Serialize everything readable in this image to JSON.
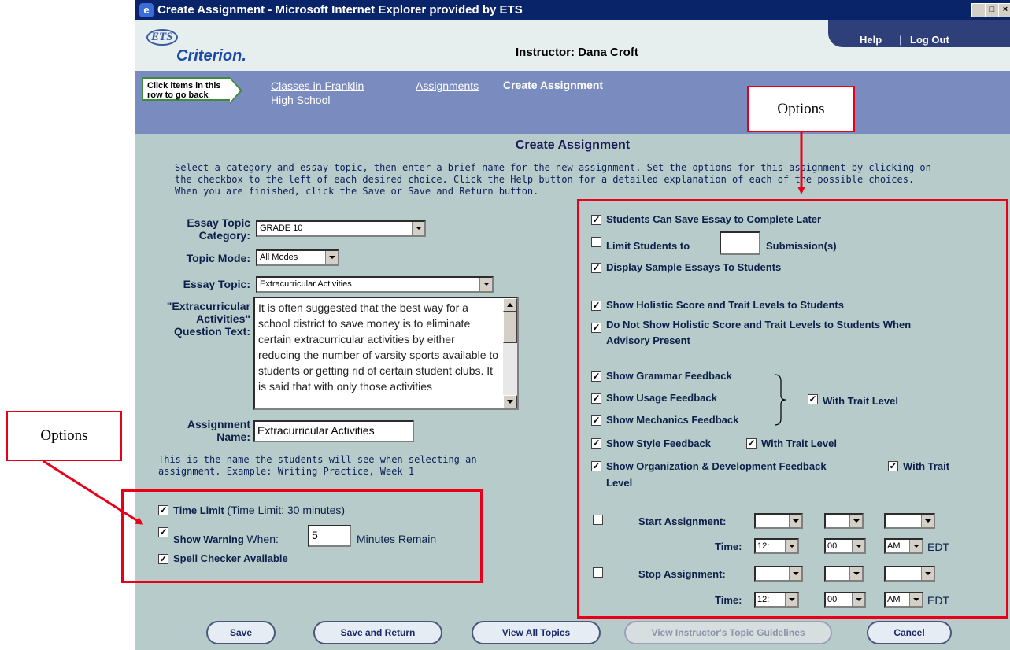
{
  "window": {
    "title": "Create Assignment - Microsoft Internet Explorer provided by ETS",
    "controls": [
      "_",
      "□",
      "×"
    ]
  },
  "header": {
    "logo_ets": "ETS",
    "logo_product": "Criterion.",
    "instructor": "Instructor: Dana Croft",
    "help": "Help",
    "separator": "|",
    "logout": "Log Out"
  },
  "breadcrumbs": {
    "hint": "Click items in this row to go back",
    "items": [
      {
        "label_line1": "Classes in Franklin",
        "label_line2": "High School"
      },
      {
        "label_line1": "Assignments"
      }
    ],
    "current": "Create Assignment"
  },
  "main": {
    "title": "Create Assignment",
    "instructions": "Select a category and essay topic, then enter a brief name for the new assignment. Set the options for this assignment by clicking on the checkbox to the left of each desired choice. Click the Help button for a detailed explanation of each of the possible choices. When you are finished, click the Save or Save and Return button.",
    "category_label_1": "Essay Topic",
    "category_label_2": "Category:",
    "category_value": "GRADE 10",
    "mode_label": "Topic Mode:",
    "mode_value": "All Modes",
    "topic_label": "Essay Topic:",
    "topic_value": "Extracurricular Activities",
    "question_label_1": "\"Extracurricular",
    "question_label_2": "Activities\"",
    "question_label_3": "Question Text:",
    "question_text": "It is often suggested that the best way for a school district to save money is to eliminate certain extracurricular activities by either reducing the number of varsity sports available to students or getting rid of certain student clubs. It is said that with only those activities",
    "name_label_1": "Assignment",
    "name_label_2": "Name:",
    "name_value": "Extracurricular Activities",
    "name_hint": "This is the name the students will see when selecting an assignment. Example: Writing Practice, Week 1"
  },
  "left_options": {
    "time_limit": "Time Limit",
    "time_limit_detail": "(Time Limit: 30 minutes)",
    "show_warning": "Show Warning",
    "when": "When:",
    "warning_minutes": "5",
    "minutes_remain": "Minutes Remain",
    "spell_checker": "Spell Checker Available"
  },
  "right_options": {
    "save_later": "Students Can Save Essay to Complete Later",
    "limit_students": "Limit Students to",
    "submissions": "Submission(s)",
    "sample_essays": "Display Sample Essays To Students",
    "holistic": "Show Holistic Score and Trait Levels to Students",
    "no_holistic_1": "Do Not Show Holistic Score and Trait Levels to Students When",
    "no_holistic_2": "Advisory Present",
    "grammar": "Show Grammar Feedback",
    "usage": "Show Usage Feedback",
    "mechanics": "Show Mechanics Feedback",
    "with_trait": "With Trait Level",
    "style": "Show Style Feedback",
    "style_trait": "With Trait Level",
    "organization": "Show Organization & Development Feedback",
    "org_trait_1": "With Trait",
    "org_trait_2": "Level",
    "start": "Start Assignment:",
    "stop": "Stop Assignment:",
    "time": "Time:",
    "hour": "12:",
    "minute": "00",
    "ampm": "AM",
    "tz": "EDT"
  },
  "buttons": {
    "save": "Save",
    "save_return": "Save and Return",
    "view_all": "View All Topics",
    "guidelines": "View Instructor's Topic Guidelines",
    "cancel": "Cancel"
  },
  "annotations": {
    "options_top": "Options",
    "options_left": "Options",
    "color": "#e8001a"
  },
  "colors": {
    "titlebar": "#0a246a",
    "page_bg": "#b7ccca",
    "nav": "#7a8cbf"
  }
}
